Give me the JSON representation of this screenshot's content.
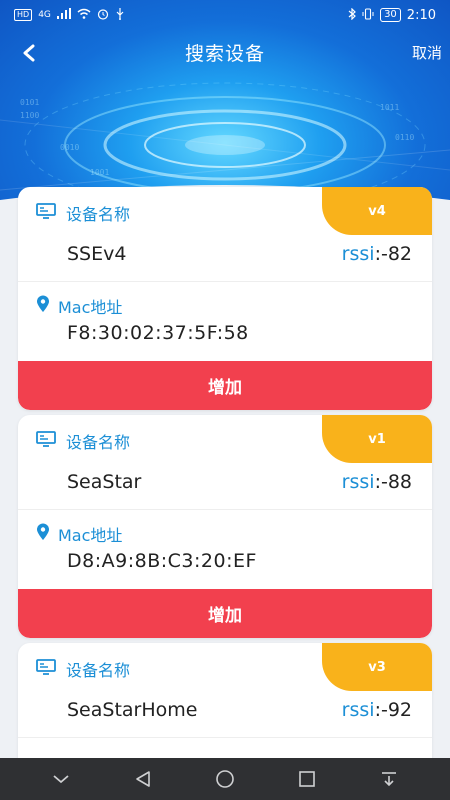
{
  "statusbar": {
    "hd": "HD",
    "network": "4G",
    "battery": "30",
    "time": "2:10"
  },
  "navbar": {
    "title": "搜索设备",
    "cancel": "取消"
  },
  "devices": [
    {
      "version": "v4",
      "name_label": "设备名称",
      "name": "SSEv4",
      "rssi_key": "rssi",
      "rssi_value": ":-82",
      "mac_label": "Mac地址",
      "mac": "F8:30:02:37:5F:58",
      "add_label": "增加"
    },
    {
      "version": "v1",
      "name_label": "设备名称",
      "name": "SeaStar",
      "rssi_key": "rssi",
      "rssi_value": ":-88",
      "mac_label": "Mac地址",
      "mac": "D8:A9:8B:C3:20:EF",
      "add_label": "增加"
    },
    {
      "version": "v3",
      "name_label": "设备名称",
      "name": "SeaStarHome",
      "rssi_key": "rssi",
      "rssi_value": ":-92"
    }
  ],
  "colors": {
    "accent": "#1c8fd6",
    "badge": "#f9b21b",
    "button": "#f2404e",
    "header": "#136fd9"
  }
}
